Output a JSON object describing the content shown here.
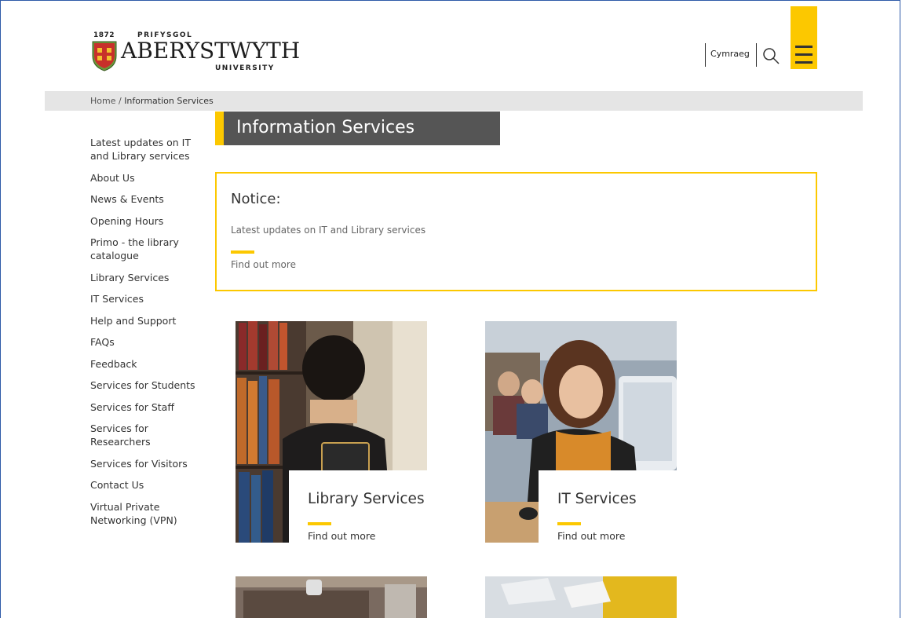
{
  "header": {
    "logo": {
      "year": "1872",
      "prefix": "PRIFYSGOL",
      "name": "ABERYSTWYTH",
      "suffix": "UNIVERSITY"
    },
    "language_link": "Cymraeg",
    "search_icon": "search-icon",
    "menu_icon": "hamburger-menu-icon",
    "accent_color": "#fcc800"
  },
  "breadcrumb": {
    "home": "Home",
    "separator": " / ",
    "current": "Information Services"
  },
  "sidebar": {
    "items": [
      {
        "label": "Latest updates on IT and Library services"
      },
      {
        "label": "About Us"
      },
      {
        "label": "News & Events"
      },
      {
        "label": "Opening Hours"
      },
      {
        "label": "Primo - the library catalogue"
      },
      {
        "label": "Library Services"
      },
      {
        "label": "IT Services"
      },
      {
        "label": "Help and Support"
      },
      {
        "label": "FAQs"
      },
      {
        "label": "Feedback"
      },
      {
        "label": "Services for Students"
      },
      {
        "label": "Services for Staff"
      },
      {
        "label": "Services for Researchers"
      },
      {
        "label": "Services for Visitors"
      },
      {
        "label": "Contact Us"
      },
      {
        "label": "Virtual Private Networking (VPN)"
      }
    ]
  },
  "main": {
    "title": "Information Services",
    "notice": {
      "heading": "Notice:",
      "text": "Latest updates on IT and Library services",
      "link": "Find out more"
    },
    "cards": [
      {
        "title": "Library Services",
        "link": "Find out more"
      },
      {
        "title": "IT Services",
        "link": "Find out more"
      }
    ]
  }
}
